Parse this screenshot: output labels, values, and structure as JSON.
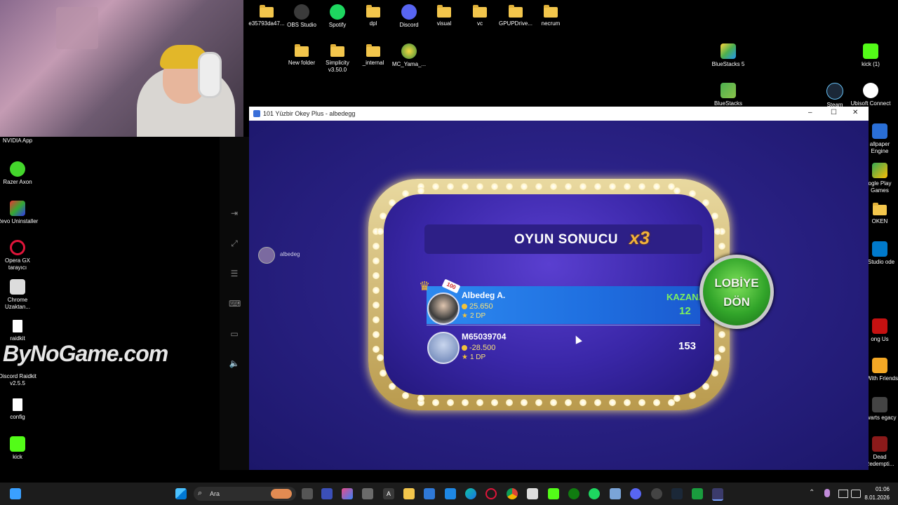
{
  "desktop": {
    "top_icons": [
      {
        "label": "e35793da47...",
        "icon": "folder-icon"
      },
      {
        "label": "OBS Studio",
        "icon": "obs-icon"
      },
      {
        "label": "Spotify",
        "icon": "spotify-icon"
      },
      {
        "label": "dpl",
        "icon": "folder-icon"
      },
      {
        "label": "Discord",
        "icon": "discord-icon"
      },
      {
        "label": "visual",
        "icon": "folder-icon"
      },
      {
        "label": "vc",
        "icon": "folder-icon"
      },
      {
        "label": "GPUPDrive...",
        "icon": "folder-icon"
      },
      {
        "label": "necrum",
        "icon": "folder-icon"
      },
      {
        "label": "New folder",
        "icon": "folder-icon"
      },
      {
        "label": "Simplicity v3.50.0",
        "icon": "folder-icon"
      },
      {
        "label": "_internal",
        "icon": "folder-icon"
      },
      {
        "label": "MC_Yama_...",
        "icon": "app-icon"
      }
    ],
    "left_icons": [
      {
        "label": "NVIDIA App"
      },
      {
        "label": "Razer Axon"
      },
      {
        "label": "Revo Uninstaller"
      },
      {
        "label": "Opera GX tarayıcı"
      },
      {
        "label": "Chrome Uzaktan..."
      },
      {
        "label": "raidkit"
      },
      {
        "label": "Discord Raidkit v2.5.5"
      },
      {
        "label": "config"
      },
      {
        "label": "kick"
      }
    ],
    "right_icons": [
      {
        "label": "BlueStacks 5"
      },
      {
        "label": "kick (1)"
      },
      {
        "label": "BlueStacks"
      },
      {
        "label": "Steam"
      },
      {
        "label": "Ubisoft Connect"
      },
      {
        "label": "allpaper Engine"
      },
      {
        "label": "ogle Play Games"
      },
      {
        "label": "OKEN"
      },
      {
        "label": "l Studio ode"
      },
      {
        "label": "ong Us"
      },
      {
        "label": "F With Friends"
      },
      {
        "label": "gwarts egacy"
      },
      {
        "label": "Dead Redempti..."
      }
    ],
    "watermark": "ByNoGame.com"
  },
  "window": {
    "title": "101 Yüzbir Okey Plus - albedegg",
    "controls": {
      "minimize": "–",
      "maximize": "☐",
      "close": "✕"
    }
  },
  "game": {
    "player_tag": "albedeg",
    "result_title": "OYUN SONUCU",
    "multiplier": "x3",
    "players": [
      {
        "name": "Albedeg A.",
        "coins": "25.650",
        "dp": "2 DP",
        "status": "KAZANAN",
        "score": "12",
        "badge": "100"
      },
      {
        "name": "M65039704",
        "coins": "-28.500",
        "dp": "1 DP",
        "status": "",
        "score": "153"
      }
    ],
    "lobby_button": {
      "line1": "LOBİYE",
      "line2": "DÖN"
    }
  },
  "taskbar": {
    "search_placeholder": "Ara",
    "time": "01:06",
    "date": "8.01.2026"
  },
  "colors": {
    "winner_row": "#2d8af0",
    "winner_text": "#7df05e",
    "lobby_green": "#32a52a",
    "board_gold": "#e9d9a0"
  }
}
